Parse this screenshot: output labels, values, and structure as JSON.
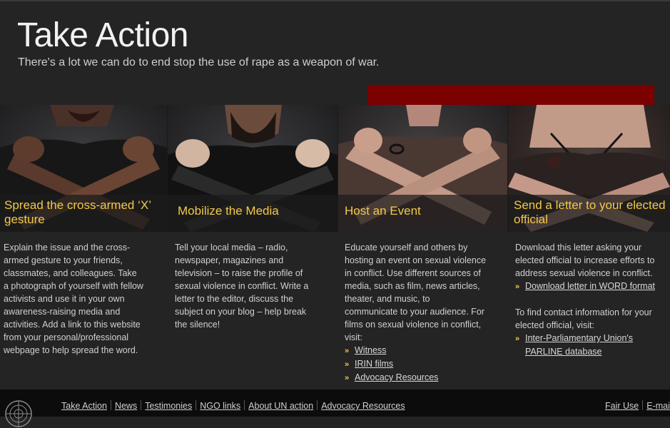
{
  "header": {
    "title": "Take Action",
    "subtitle": "There's a lot we can do to end stop the use of rape as a weapon of war."
  },
  "colors": {
    "accent": "#f3c84a",
    "red_bar": "#7b0000",
    "background": "#242424",
    "footer": "#0c0c0c"
  },
  "panels": [
    {
      "caption": "Spread the cross-armed ‘X’ gesture"
    },
    {
      "caption": "Mobilize the Media"
    },
    {
      "caption": "Host an Event"
    },
    {
      "caption": "Send a letter to your elected official"
    }
  ],
  "columns": {
    "col1": {
      "lines": [
        "Explain the issue and the cross-",
        "armed gesture to your friends,",
        "classmates, and colleagues. Take",
        "a photograph of yourself with fellow",
        "activists and use it in your own",
        "awareness-raising media and",
        "activities. Add a link to this website",
        "from your personal/professional",
        "webpage to help spread the word."
      ]
    },
    "col2": {
      "lines": [
        "Tell your local media – radio,",
        "newspaper, magazines and",
        "television – to raise the profile of",
        "sexual violence in conflict. Write a",
        "letter to the editor, discuss the",
        "subject on your blog – help break",
        "the silence!"
      ]
    },
    "col3": {
      "lines": [
        "Educate yourself and others by",
        "hosting an event on sexual violence",
        "in conflict. Use different sources of",
        "media, such as film, news articles,",
        "theater, and music, to",
        "communicate to your audience. For",
        "films on sexual violence in conflict,",
        "visit:"
      ],
      "links": [
        "Witness",
        "IRIN films",
        "Advocacy Resources"
      ]
    },
    "col4": {
      "lines": [
        "Download this letter asking your",
        "elected official to increase efforts to",
        "address sexual violence in conflict."
      ],
      "download_link": "Download letter in WORD format",
      "lines2": [
        "To find contact information for your",
        "elected official, visit:"
      ],
      "parline_link_1": "Inter-Parliamentary Union's",
      "parline_link_2": "PARLINE database"
    }
  },
  "footer": {
    "logo_icon": "un-emblem-icon",
    "nav": [
      "Take Action",
      "News",
      "Testimonies",
      "NGO links",
      "About UN action",
      "Advocacy Resources"
    ],
    "right": [
      "Fair Use",
      "E-mail"
    ]
  }
}
